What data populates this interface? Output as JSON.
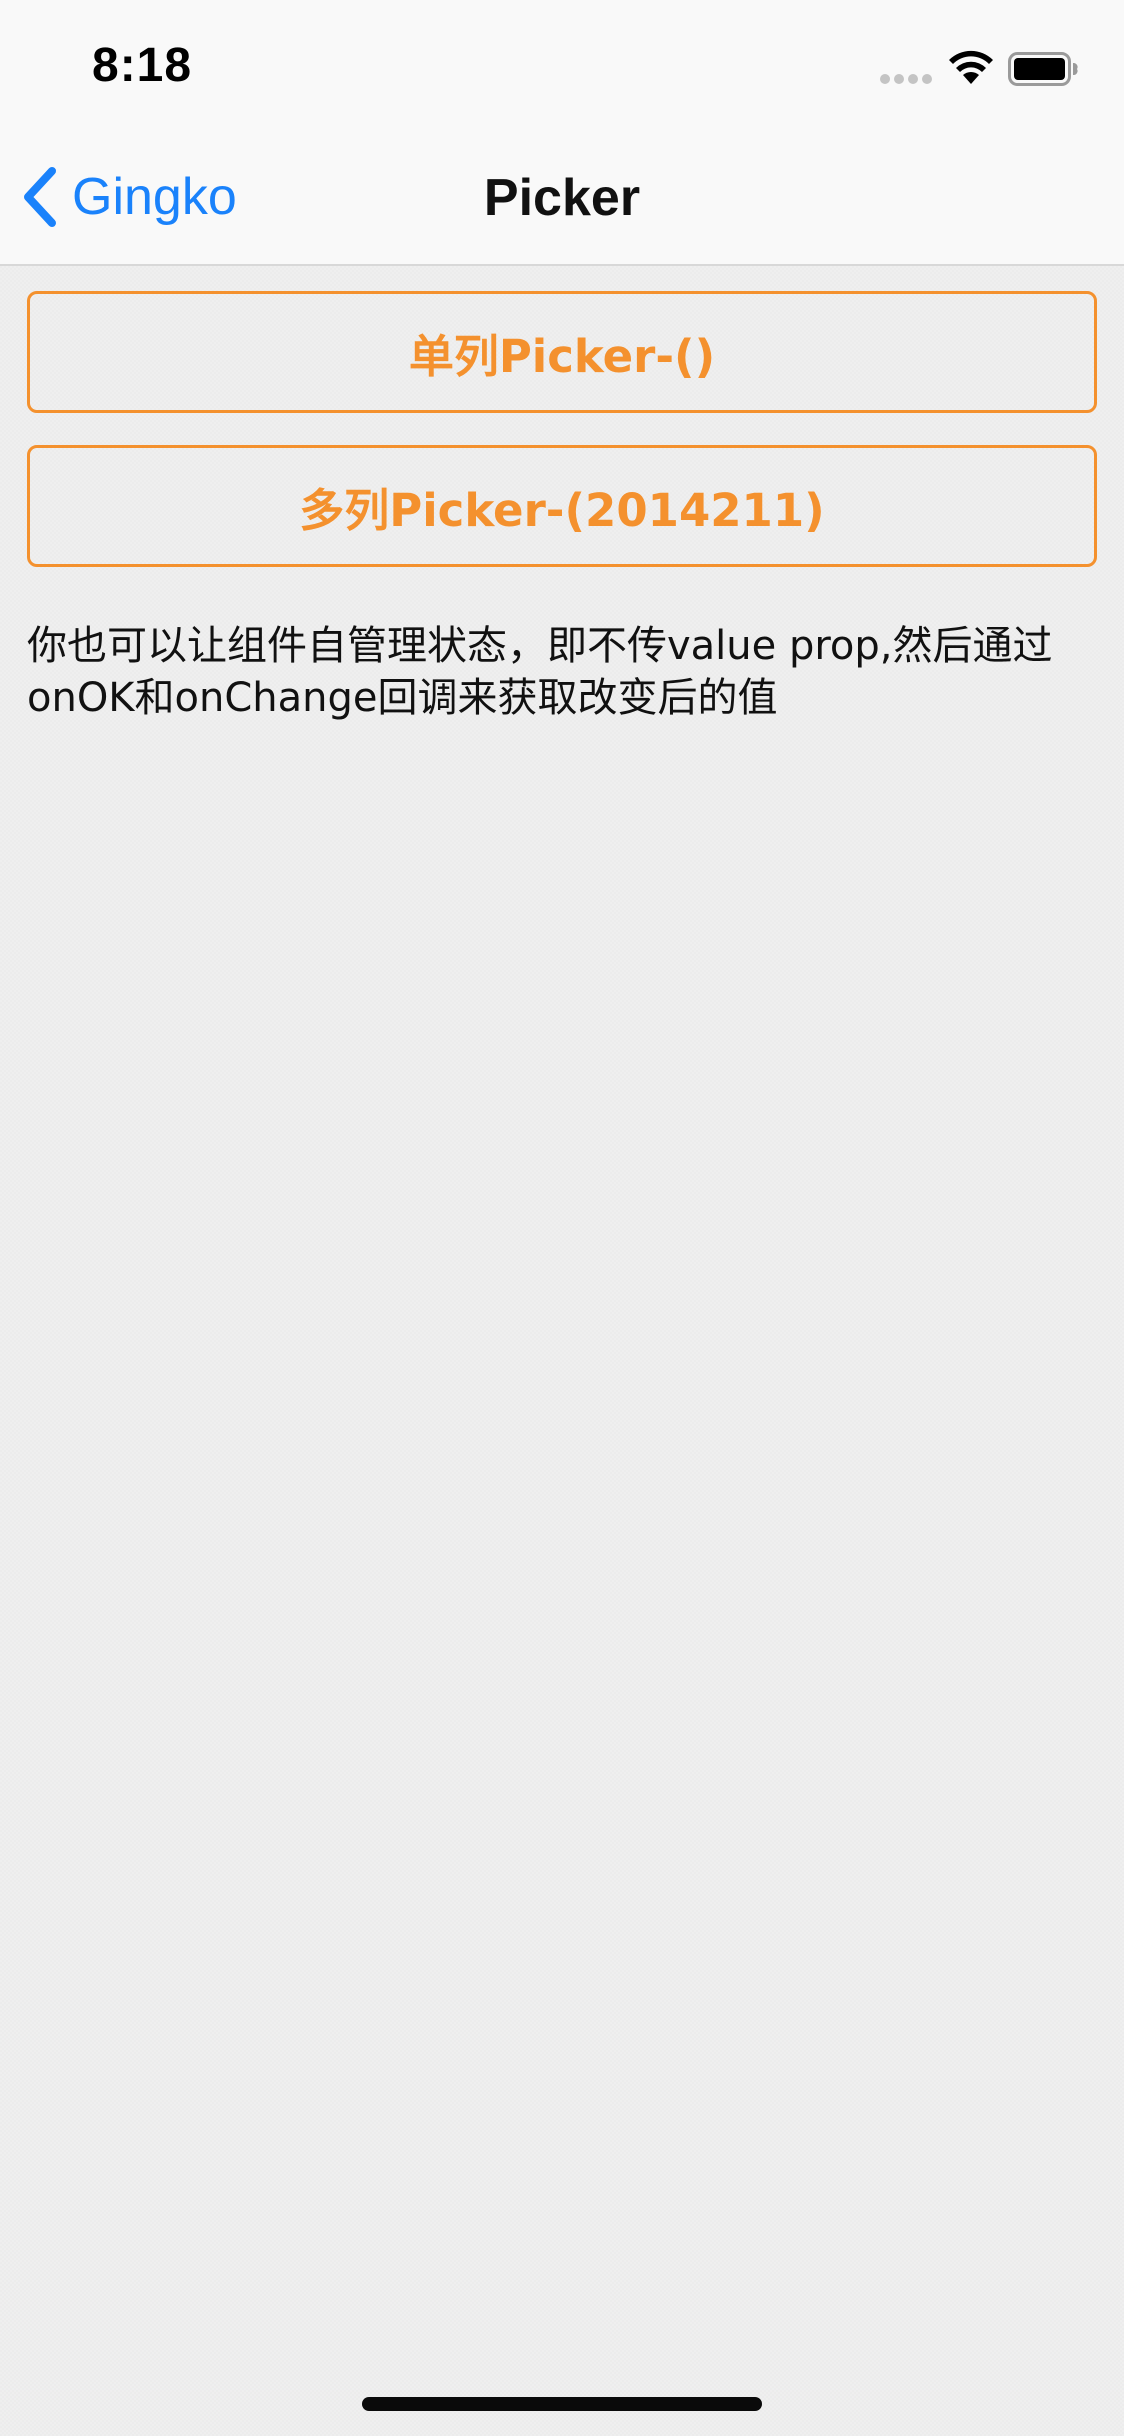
{
  "status_bar": {
    "time": "8:18",
    "icons": [
      "signal-dots-icon",
      "wifi-icon",
      "battery-icon"
    ]
  },
  "nav_bar": {
    "back_label": "Gingko",
    "title": "Picker"
  },
  "buttons": {
    "single_picker": "单列Picker-()",
    "multi_picker": "多列Picker-(2014211)"
  },
  "description": "你也可以让组件自管理状态，即不传value prop,然后通过onOK和onChange回调来获取改变后的值",
  "colors": {
    "accent": "#f4912e",
    "link": "#1a82fb",
    "background": "#efefef",
    "bar": "#f9f9f9"
  }
}
